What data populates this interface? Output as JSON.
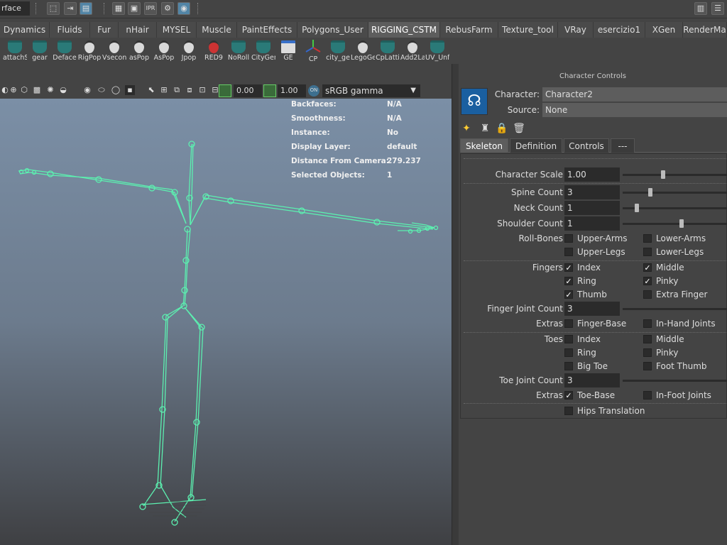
{
  "topbar": {
    "mode_field": "rface",
    "icons": [
      "select-tool-icon",
      "move-tool-icon",
      "render-settings-icon",
      "render-view-icon",
      "render-current-icon",
      "ipr-render-icon",
      "render-settings-gear-icon",
      "hypershade-icon"
    ],
    "ipr_label": "IPR"
  },
  "shelf_tabs": [
    {
      "label": "Dynamics"
    },
    {
      "label": "Fluids"
    },
    {
      "label": "Fur"
    },
    {
      "label": "nHair"
    },
    {
      "label": "MYSEL"
    },
    {
      "label": "Muscle"
    },
    {
      "label": "PaintEffects"
    },
    {
      "label": "Polygons_User"
    },
    {
      "label": "RIGGING_CSTM"
    },
    {
      "label": "RebusFarm"
    },
    {
      "label": "Texture_tool"
    },
    {
      "label": "VRay"
    },
    {
      "label": "esercizio1"
    },
    {
      "label": "XGen"
    },
    {
      "label": "RenderMa"
    }
  ],
  "active_shelf_tab": "RIGGING_CSTM",
  "shelf": [
    {
      "label": "attachS",
      "icon": "teal-script-icon"
    },
    {
      "label": "gear",
      "icon": "teal-script-icon"
    },
    {
      "label": "Deface",
      "icon": "teal-script-icon"
    },
    {
      "label": "RigPop",
      "icon": "python-egg-icon"
    },
    {
      "label": "Vsecond",
      "icon": "python-egg-icon"
    },
    {
      "label": "asPop",
      "icon": "python-egg-icon"
    },
    {
      "label": "AsPop",
      "icon": "python-egg-icon"
    },
    {
      "label": "Jpop",
      "icon": "python-egg-icon"
    },
    {
      "label": "RED9",
      "icon": "red9-icon"
    },
    {
      "label": "NoRoll",
      "icon": "teal-script-icon"
    },
    {
      "label": "CityGen",
      "icon": "teal-script-icon"
    },
    {
      "label": "GE",
      "icon": "window-icon"
    },
    {
      "label": "CP",
      "icon": "axes-icon"
    },
    {
      "label": "city_ge",
      "icon": "teal-script-icon"
    },
    {
      "label": "LegoGe",
      "icon": "python-egg-icon"
    },
    {
      "label": "CpLatti",
      "icon": "teal-script-icon"
    },
    {
      "label": "Add2La",
      "icon": "python-egg-icon"
    },
    {
      "label": "UV_Unf",
      "icon": "teal-script-icon"
    }
  ],
  "viewport_toolbar": {
    "exposure": "0.00",
    "gamma": "1.00",
    "color_space": "sRGB gamma"
  },
  "hud": [
    {
      "key": "Backfaces:",
      "value": "N/A"
    },
    {
      "key": "Smoothness:",
      "value": "N/A"
    },
    {
      "key": "Instance:",
      "value": "No"
    },
    {
      "key": "Display Layer:",
      "value": "default"
    },
    {
      "key": "Distance From Camera:",
      "value": "279.237"
    },
    {
      "key": "Selected Objects:",
      "value": "1"
    }
  ],
  "panel": {
    "title": "Character Controls",
    "character_label": "Character:",
    "character_value": "Character2",
    "source_label": "Source:",
    "source_value": "None",
    "tabs": [
      {
        "label": "Skeleton"
      },
      {
        "label": "Definition"
      },
      {
        "label": "Controls"
      },
      {
        "label": "---"
      }
    ],
    "active_tab": "Skeleton",
    "character_scale": {
      "label": "Character Scale",
      "value": "1.00",
      "slider": 0.38
    },
    "spine_count": {
      "label": "Spine Count",
      "value": "3",
      "slider": 0.26
    },
    "neck_count": {
      "label": "Neck Count",
      "value": "1",
      "slider": 0.12
    },
    "shoulder_count": {
      "label": "Shoulder Count",
      "value": "1",
      "slider": 0.55
    },
    "roll_bones": {
      "label": "Roll-Bones",
      "items": [
        {
          "label": "Upper-Arms",
          "checked": false
        },
        {
          "label": "Lower-Arms",
          "checked": false
        },
        {
          "label": "Upper-Legs",
          "checked": false
        },
        {
          "label": "Lower-Legs",
          "checked": false
        }
      ]
    },
    "fingers": {
      "label": "Fingers",
      "items": [
        {
          "label": "Index",
          "checked": true
        },
        {
          "label": "Middle",
          "checked": true
        },
        {
          "label": "Ring",
          "checked": true
        },
        {
          "label": "Pinky",
          "checked": true
        },
        {
          "label": "Thumb",
          "checked": true
        },
        {
          "label": "Extra Finger",
          "checked": false
        }
      ]
    },
    "finger_joint_count": {
      "label": "Finger Joint Count",
      "value": "3"
    },
    "finger_extras": {
      "label": "Extras",
      "items": [
        {
          "label": "Finger-Base",
          "checked": false
        },
        {
          "label": "In-Hand Joints",
          "checked": false
        }
      ]
    },
    "toes": {
      "label": "Toes",
      "items": [
        {
          "label": "Index",
          "checked": false
        },
        {
          "label": "Middle",
          "checked": false
        },
        {
          "label": "Ring",
          "checked": false
        },
        {
          "label": "Pinky",
          "checked": false
        },
        {
          "label": "Big Toe",
          "checked": false
        },
        {
          "label": "Foot Thumb",
          "checked": false
        }
      ]
    },
    "toe_joint_count": {
      "label": "Toe Joint Count",
      "value": "3"
    },
    "toe_extras": {
      "label": "Extras",
      "items": [
        {
          "label": "Toe-Base",
          "checked": true
        },
        {
          "label": "In-Foot Joints",
          "checked": false
        }
      ]
    },
    "hips_translation": {
      "label": "Hips Translation",
      "checked": false
    }
  },
  "colors": {
    "skeleton": "#5cf0b0",
    "active_tab": "#5d5d5d",
    "accent_blue": "#5285a6"
  }
}
